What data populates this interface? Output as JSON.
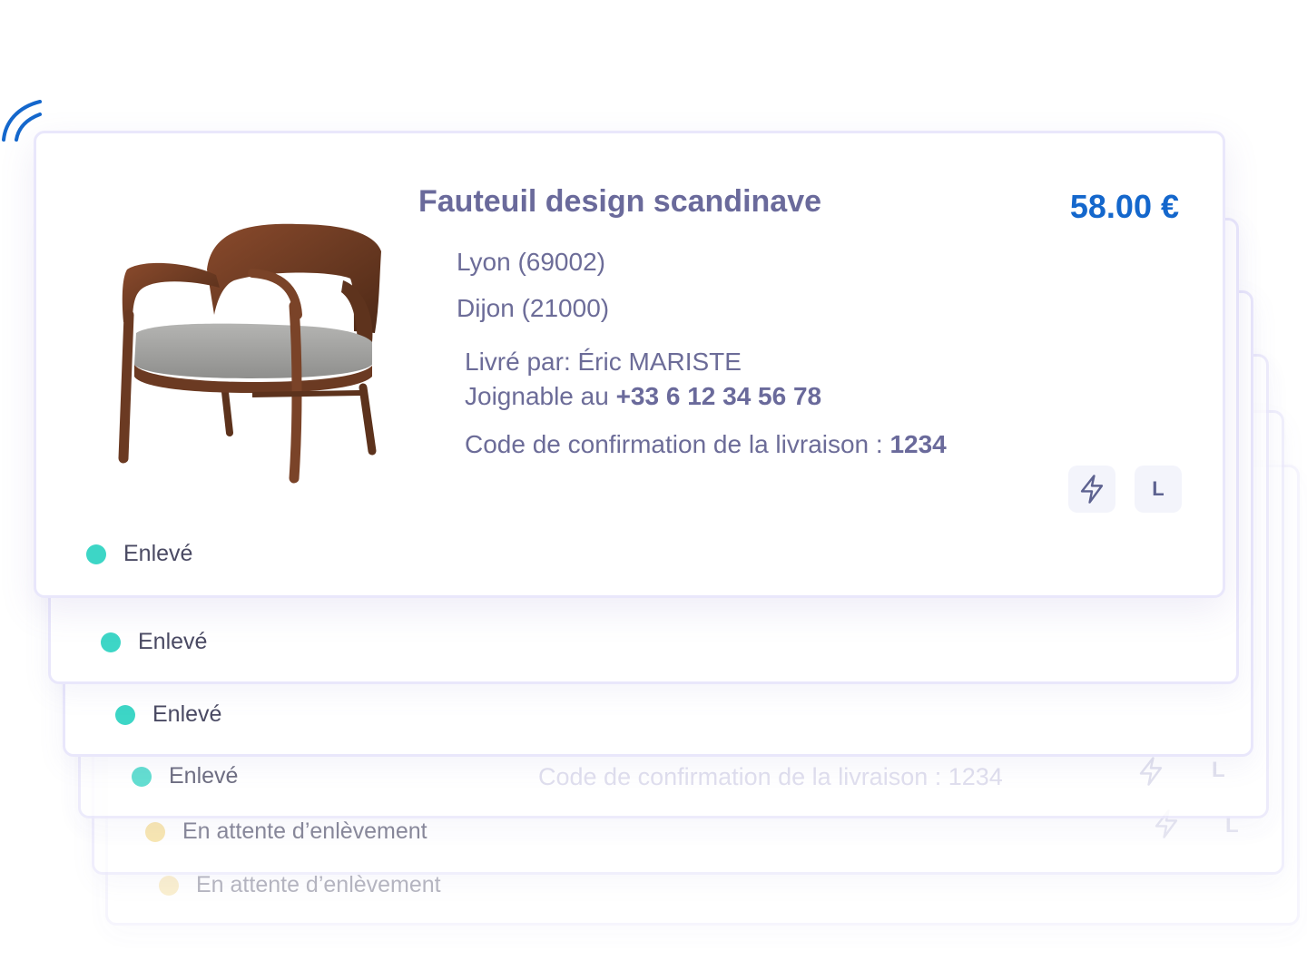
{
  "product": {
    "title": "Fauteuil design scandinave",
    "price": "58.00 €",
    "pickup_city": "Lyon (69002)",
    "delivery_city": "Dijon (21000)",
    "courier_prefix": "Livré par: ",
    "courier_name": "Éric MARISTE",
    "phone_prefix": "Joignable au ",
    "phone": "+33 6 12 34 56 78",
    "code_prefix": "Code de confirmation de la livraison : ",
    "code": "1234",
    "badge_size": "L"
  },
  "cards": [
    {
      "status": "Enlevé",
      "status_color": "#3dd6c6"
    },
    {
      "status": "Enlevé",
      "status_color": "#3dd6c6"
    },
    {
      "status": "Enlevé",
      "status_color": "#3dd6c6"
    },
    {
      "status": "Enlevé",
      "status_color": "#3dd6c6"
    },
    {
      "status": "En attente d’enlèvement",
      "status_color": "#f5d98a"
    },
    {
      "status": "En attente d’enlèvement",
      "status_color": "#f5d98a"
    }
  ],
  "ghost": {
    "code_line": "Code de confirmation de la livraison : 1234",
    "badge_size": "L"
  },
  "icons": {
    "signal": "signal-waves-icon",
    "lightning": "lightning-icon",
    "chair": "armchair-image"
  },
  "colors": {
    "accent_blue": "#1467cc",
    "title_purple": "#6a6a9b",
    "status_teal": "#3dd6c6",
    "status_yellow": "#f5d98a",
    "card_border": "#e9e7fb"
  }
}
